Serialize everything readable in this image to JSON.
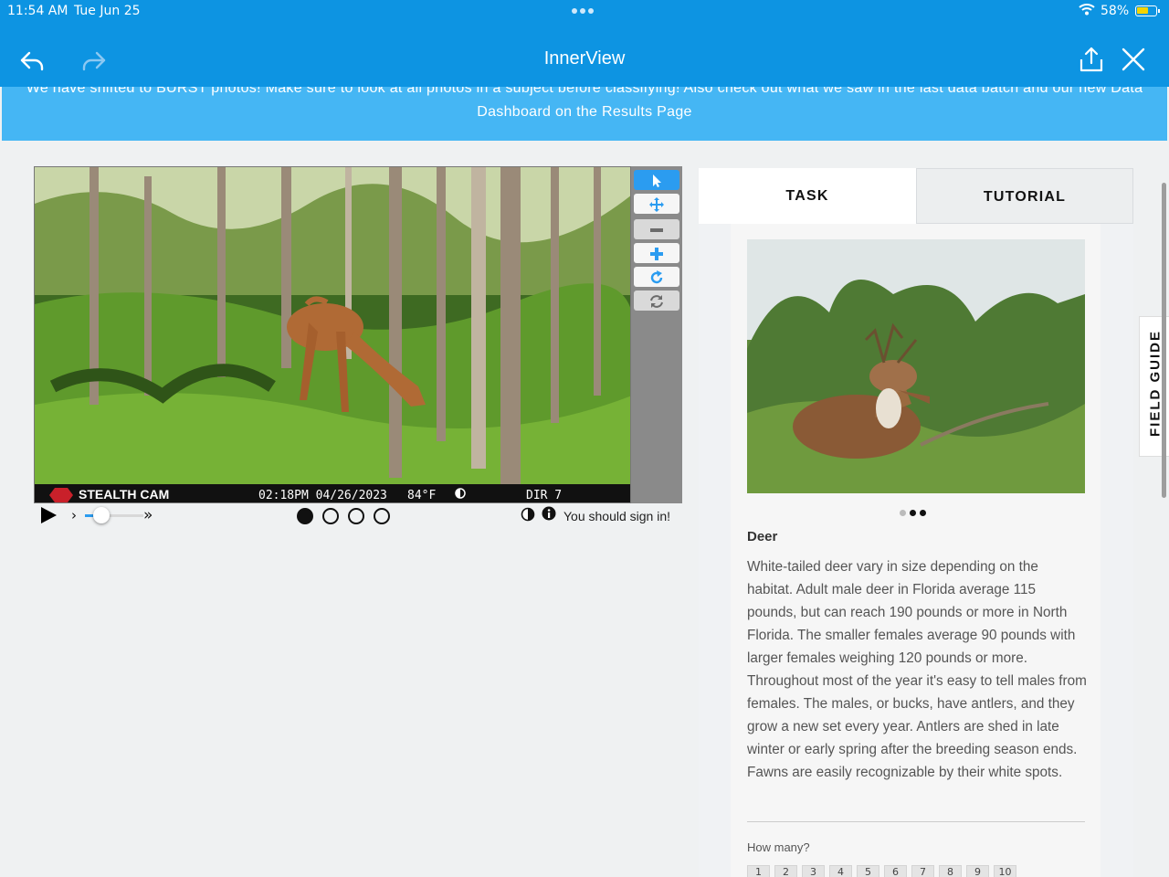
{
  "status": {
    "time": "11:54 AM",
    "date": "Tue Jun 25",
    "battery": "58%"
  },
  "nav": {
    "title": "InnerView",
    "back": "back",
    "forward": "forward",
    "share": "share",
    "close": "close"
  },
  "banner": {
    "text": "We have shifted to BURST photos! Make sure to look at all photos in a subject before classifying! Also check out what we saw in the last data batch and our new Data Dashboard on the Results Page"
  },
  "camera_overlay": {
    "brand": "STEALTH CAM",
    "timestamp": "02:18PM 04/26/2023",
    "temperature": "84°F",
    "dir": "DIR 7"
  },
  "viewer": {
    "tools": [
      "pointer-icon",
      "move-icon",
      "zoom-out-icon",
      "zoom-in-icon",
      "rotate-icon",
      "reset-icon"
    ],
    "frames": [
      true,
      false,
      false,
      false
    ],
    "speed_level": 0.15,
    "signin_text": "You should sign in!"
  },
  "tabs": {
    "task": "TASK",
    "tutorial": "TUTORIAL"
  },
  "guide": {
    "carousel": [
      "inactive",
      "active",
      "active"
    ],
    "name": "Deer",
    "description": "White-tailed deer vary in size depending on the habitat. Adult male deer in Florida average 115 pounds, but can reach 190 pounds or more in North Florida. The smaller females average 90 pounds with larger females weighing 120 pounds or more. Throughout most of the year it's easy to tell males from females. The males, or bucks, have antlers, and they grow a new set every year. Antlers are shed in late winter or early spring after the breeding season ends. Fawns are easily recognizable by their white spots.",
    "how_many": "How many?",
    "counts": [
      "1",
      "2",
      "3",
      "4",
      "5",
      "6",
      "7",
      "8",
      "9",
      "10"
    ]
  },
  "field_guide_label": "FIELD GUIDE",
  "colors": {
    "nav": "#0d94e2",
    "banner": "#45b6f4",
    "accent": "#2b9cf0"
  }
}
